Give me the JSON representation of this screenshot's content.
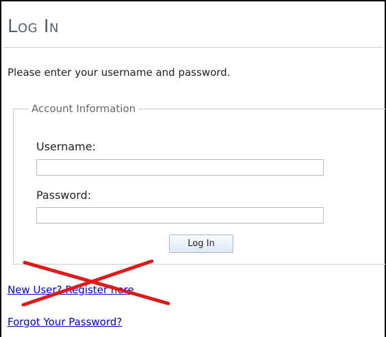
{
  "page": {
    "title": "Log In",
    "instructions": "Please enter your username and password."
  },
  "account_info": {
    "legend": "Account Information",
    "username_label": "Username:",
    "username_value": "",
    "password_label": "Password:",
    "password_value": "",
    "login_button": "Log In"
  },
  "links": {
    "register": "New User? Register here",
    "forgot_password": "Forgot Your Password?"
  },
  "annotations": {
    "cross_color": "#e01818"
  }
}
